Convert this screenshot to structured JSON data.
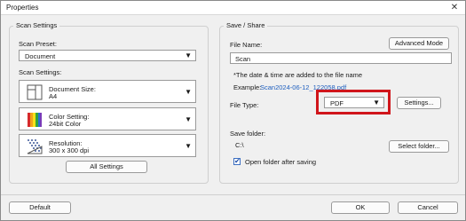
{
  "window": {
    "title": "Properties",
    "close_symbol": "✕"
  },
  "scan_settings": {
    "legend": "Scan Settings",
    "preset_label": "Scan Preset:",
    "preset_value": "Document",
    "settings_label": "Scan Settings:",
    "document_size": {
      "title": "Document Size:",
      "value": "A4",
      "icon": "document-size-icon"
    },
    "color_setting": {
      "title": "Color Setting:",
      "value": "24bit Color",
      "icon": "color-setting-icon"
    },
    "resolution": {
      "title": "Resolution:",
      "value": "300 x 300 dpi",
      "icon": "resolution-icon"
    },
    "all_settings_label": "All Settings"
  },
  "save_share": {
    "legend": "Save / Share",
    "file_name_label": "File Name:",
    "advanced_mode_label": "Advanced Mode",
    "file_name_value": "Scan",
    "note": "*The date & time are added to the file name",
    "example_label": "Example:",
    "example_value": "Scan2024-06-12_122058.pdf",
    "file_type_label": "File Type:",
    "file_type_value": "PDF",
    "settings_button_label": "Settings...",
    "save_folder_label": "Save folder:",
    "save_folder_value": "C:\\",
    "select_folder_label": "Select folder...",
    "open_folder_label": "Open folder after saving",
    "open_folder_checked": true
  },
  "footer": {
    "default_label": "Default",
    "ok_label": "OK",
    "cancel_label": "Cancel"
  },
  "colors": {
    "highlight": "#d0151b",
    "link": "#1f5fbf"
  }
}
